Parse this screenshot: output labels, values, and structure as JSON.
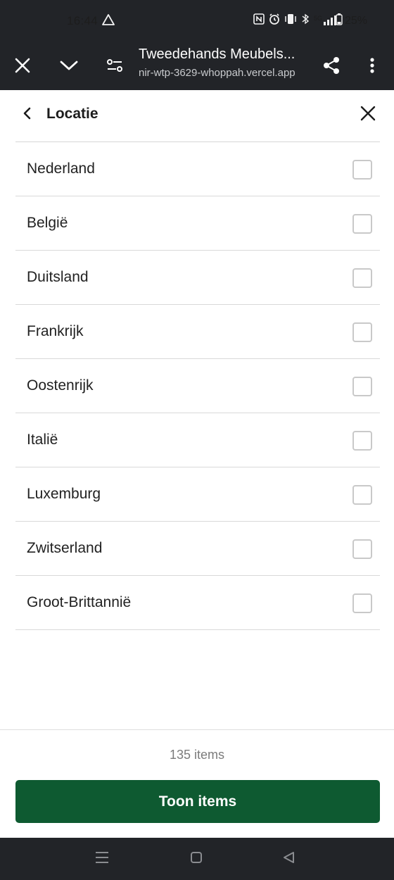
{
  "status_bar": {
    "time": "16:44",
    "network": "5G",
    "battery": "25%",
    "icons": [
      "warning-icon",
      "nfc-icon",
      "alarm-icon",
      "vibrate-icon",
      "bluetooth-icon",
      "signal-icon",
      "battery-icon"
    ]
  },
  "browser": {
    "title": "Tweedehands Meubels...",
    "url": "nir-wtp-3629-whoppah.vercel.app"
  },
  "sheet": {
    "title": "Locatie"
  },
  "locations": [
    {
      "label": "Nederland",
      "checked": false
    },
    {
      "label": "België",
      "checked": false
    },
    {
      "label": "Duitsland",
      "checked": false
    },
    {
      "label": "Frankrijk",
      "checked": false
    },
    {
      "label": "Oostenrijk",
      "checked": false
    },
    {
      "label": "Italië",
      "checked": false
    },
    {
      "label": "Luxemburg",
      "checked": false
    },
    {
      "label": "Zwitserland",
      "checked": false
    },
    {
      "label": "Groot-Brittannië",
      "checked": false
    }
  ],
  "footer": {
    "count_text": "135 items",
    "button_label": "Toon items"
  },
  "colors": {
    "system_bar": "#222428",
    "primary": "#0e5a31",
    "divider": "#d9d9d9",
    "checkbox_border": "#c9c9c9"
  }
}
